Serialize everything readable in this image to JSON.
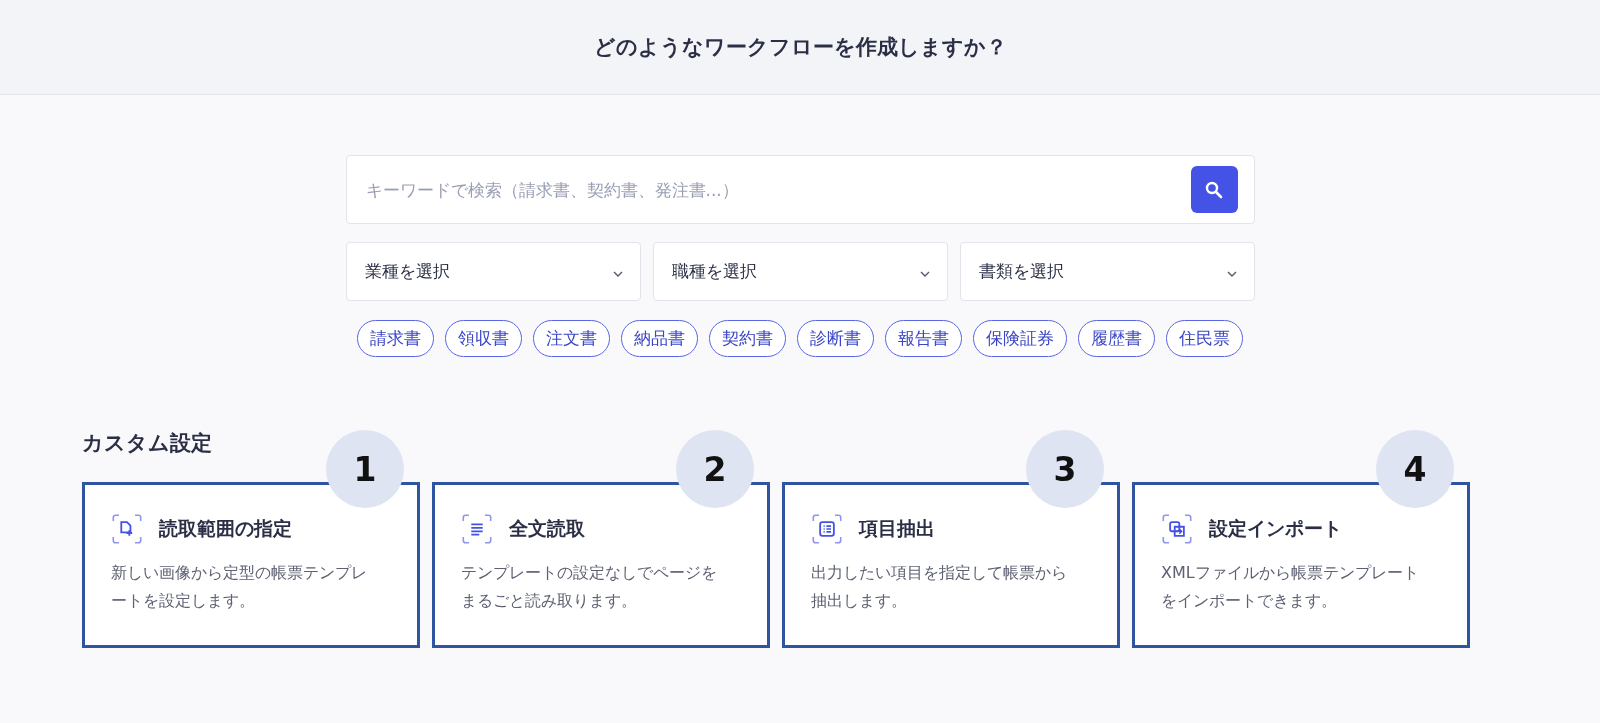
{
  "header": {
    "title": "どのようなワークフローを作成しますか？"
  },
  "search": {
    "placeholder": "キーワードで検索（請求書、契約書、発注書...）"
  },
  "filters": [
    {
      "label": "業種を選択"
    },
    {
      "label": "職種を選択"
    },
    {
      "label": "書類を選択"
    }
  ],
  "tags": [
    "請求書",
    "領収書",
    "注文書",
    "納品書",
    "契約書",
    "診断書",
    "報告書",
    "保険証券",
    "履歴書",
    "住民票"
  ],
  "section": {
    "title": "カスタム設定"
  },
  "cards": [
    {
      "kind": "region",
      "badge": "1",
      "title": "読取範囲の指定",
      "description": "新しい画像から定型の帳票テンプレートを設定します。"
    },
    {
      "kind": "fulltext",
      "badge": "2",
      "title": "全文読取",
      "description": "テンプレートの設定なしでページをまるごと読み取ります。"
    },
    {
      "kind": "items",
      "badge": "3",
      "title": "項目抽出",
      "description": "出力したい項目を指定して帳票から抽出します。"
    },
    {
      "kind": "import",
      "badge": "4",
      "title": "設定インポート",
      "description": "XMLファイルから帳票テンプレートをインポートできます。"
    }
  ]
}
